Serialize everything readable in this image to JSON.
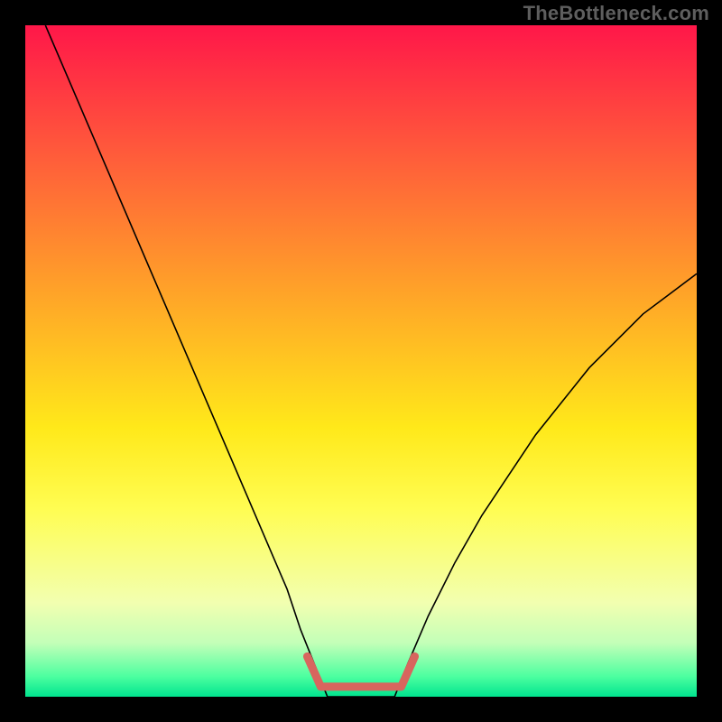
{
  "watermark": "TheBottleneck.com",
  "chart_data": {
    "type": "line",
    "title": "",
    "xlabel": "",
    "ylabel": "",
    "xlim": [
      0,
      100
    ],
    "ylim": [
      0,
      100
    ],
    "background_gradient": {
      "stops": [
        {
          "offset": 0.0,
          "color": "#ff1749"
        },
        {
          "offset": 0.2,
          "color": "#ff5e3a"
        },
        {
          "offset": 0.4,
          "color": "#ffa428"
        },
        {
          "offset": 0.6,
          "color": "#ffe91a"
        },
        {
          "offset": 0.72,
          "color": "#fffd52"
        },
        {
          "offset": 0.86,
          "color": "#f2ffb0"
        },
        {
          "offset": 0.92,
          "color": "#c3ffb8"
        },
        {
          "offset": 0.97,
          "color": "#4cffa0"
        },
        {
          "offset": 1.0,
          "color": "#00e48e"
        }
      ]
    },
    "series": [
      {
        "name": "bottleneck-curve",
        "color": "#000000",
        "width": 1.6,
        "x": [
          3,
          6,
          9,
          12,
          15,
          18,
          21,
          24,
          27,
          30,
          33,
          36,
          39,
          41,
          43,
          45,
          55,
          57,
          60,
          64,
          68,
          72,
          76,
          80,
          84,
          88,
          92,
          96,
          100
        ],
        "values": [
          100,
          93,
          86,
          79,
          72,
          65,
          58,
          51,
          44,
          37,
          30,
          23,
          16,
          10,
          5,
          0,
          0,
          5,
          12,
          20,
          27,
          33,
          39,
          44,
          49,
          53,
          57,
          60,
          63
        ]
      }
    ],
    "highlight_segment": {
      "name": "optimal-flat",
      "color": "#d8655e",
      "width": 9,
      "points": [
        {
          "x": 42,
          "y": 6
        },
        {
          "x": 44,
          "y": 1.5
        },
        {
          "x": 56,
          "y": 1.5
        },
        {
          "x": 58,
          "y": 6
        }
      ]
    }
  }
}
